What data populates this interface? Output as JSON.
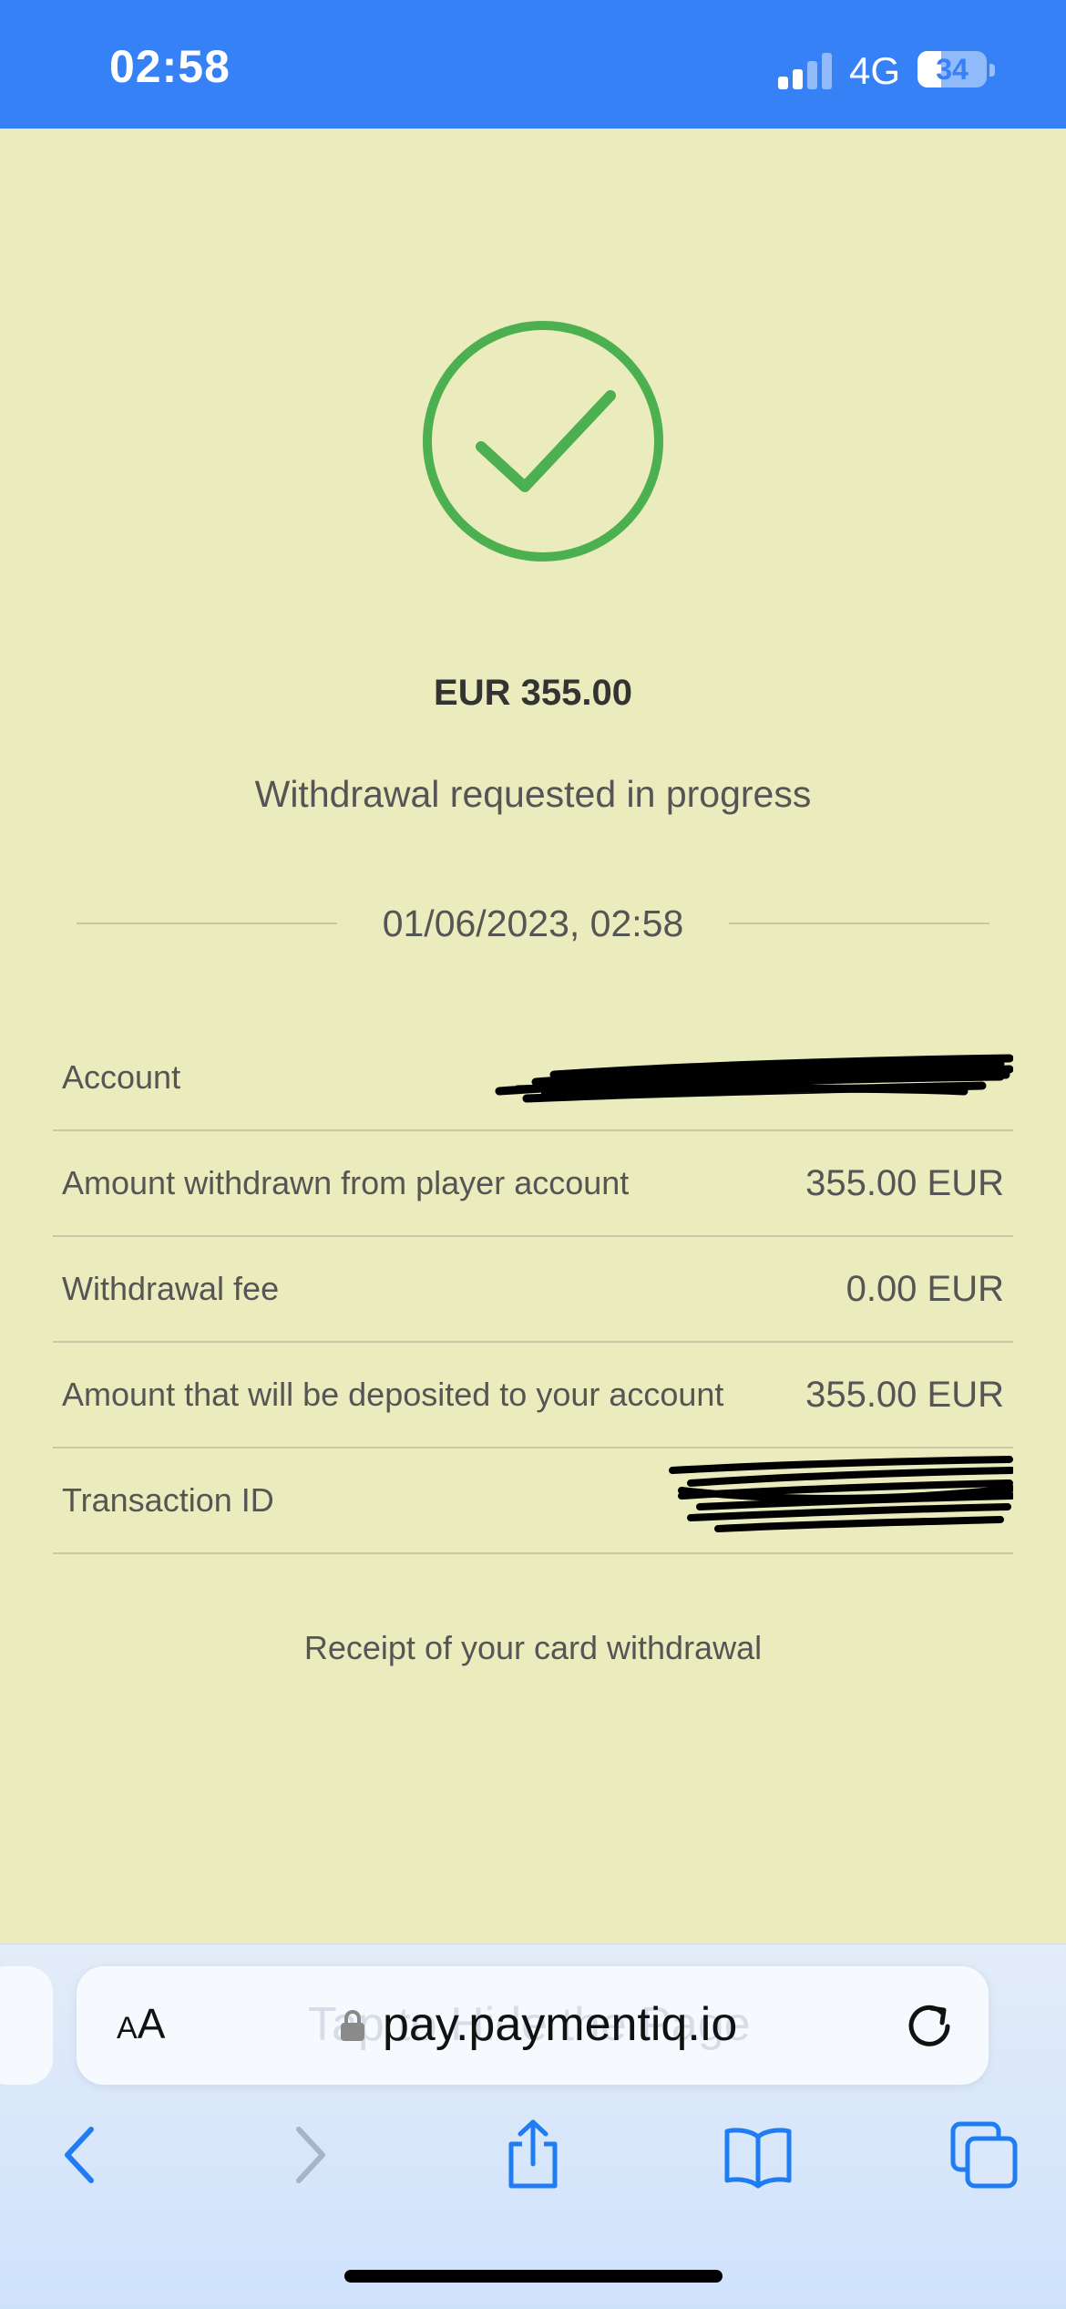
{
  "status_bar": {
    "time": "02:58",
    "network": "4G",
    "battery_level": "34",
    "battery_fraction": 0.34,
    "signal_bars_active": 2,
    "background_color": "#3581f5"
  },
  "receipt": {
    "status_icon": "check-circle-icon",
    "accent_color": "#4caf50",
    "amount": "EUR 355.00",
    "status_message": "Withdrawal requested in progress",
    "datetime": "01/06/2023, 02:58",
    "rows": [
      {
        "label": "Account",
        "value": "",
        "redacted": true
      },
      {
        "label": "Amount withdrawn from player account",
        "value": "355.00 EUR"
      },
      {
        "label": "Withdrawal fee",
        "value": "0.00 EUR"
      },
      {
        "label": "Amount that will be deposited to your account",
        "value": "355.00 EUR"
      },
      {
        "label": "Transaction ID",
        "value": "",
        "redacted": true
      }
    ],
    "receipt_link": "Receipt of your card withdrawal"
  },
  "browser": {
    "text_size_label_small": "A",
    "text_size_label_large": "A",
    "ghost_text": "Tap to Hide the Page",
    "url": "pay.paymentiq.io",
    "toolbar_icons": [
      "back-icon",
      "forward-icon",
      "share-icon",
      "bookmarks-icon",
      "tabs-icon"
    ],
    "accent_color": "#1f7cf2"
  }
}
